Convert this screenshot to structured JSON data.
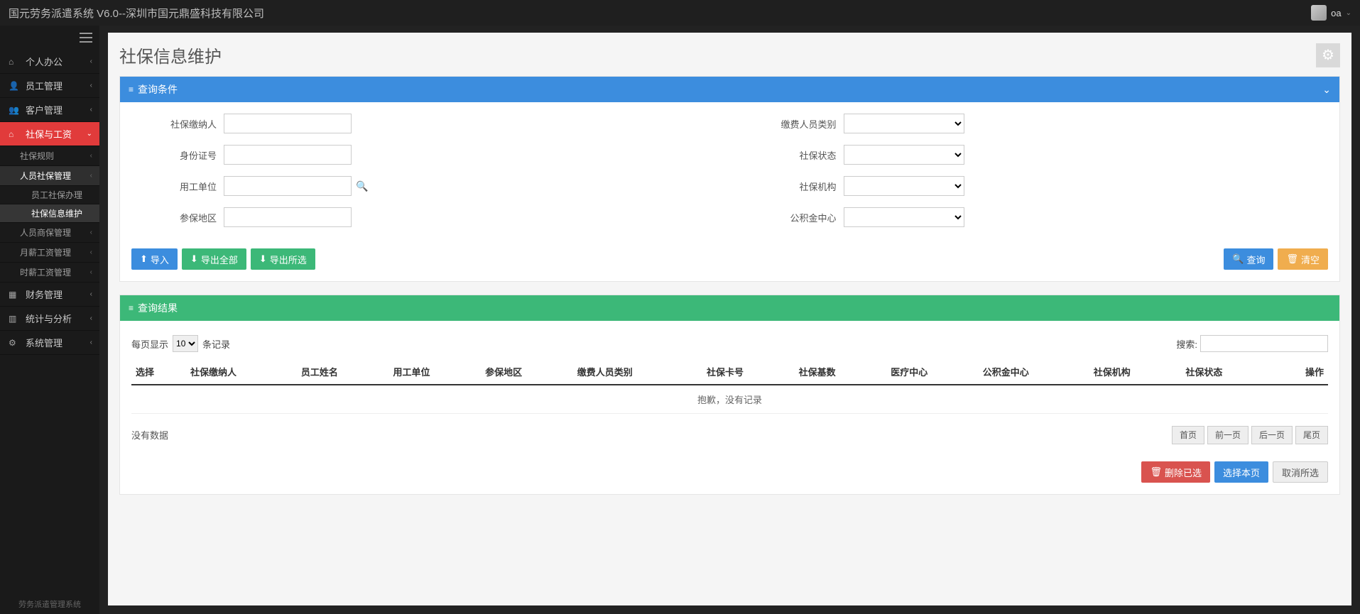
{
  "app_title": "国元劳务派遣系统 V6.0--深圳市国元鼎盛科技有限公司",
  "user": {
    "name": "oa"
  },
  "sidebar": {
    "items": [
      {
        "icon": "home-icon",
        "label": "个人办公",
        "expandable": true
      },
      {
        "icon": "user-icon",
        "label": "员工管理",
        "expandable": true
      },
      {
        "icon": "users-icon",
        "label": "客户管理",
        "expandable": true
      },
      {
        "icon": "home-icon",
        "label": "社保与工资",
        "expandable": true,
        "active": true,
        "children": [
          {
            "label": "社保规则",
            "expandable": true
          },
          {
            "label": "人员社保管理",
            "expandable": true,
            "selected": true,
            "children": [
              {
                "label": "员工社保办理"
              },
              {
                "label": "社保信息维护",
                "selected": true
              }
            ]
          },
          {
            "label": "人员商保管理",
            "expandable": true
          },
          {
            "label": "月薪工资管理",
            "expandable": true
          },
          {
            "label": "时薪工资管理",
            "expandable": true
          }
        ]
      },
      {
        "icon": "dashboard-icon",
        "label": "财务管理",
        "expandable": true
      },
      {
        "icon": "chart-icon",
        "label": "统计与分析",
        "expandable": true
      },
      {
        "icon": "gear-icon",
        "label": "系统管理",
        "expandable": true
      }
    ],
    "footer": "劳务派遣管理系统"
  },
  "page": {
    "title": "社保信息维护",
    "query_panel_title": "查询条件",
    "result_panel_title": "查询结果",
    "form": {
      "left": [
        {
          "key": "payer",
          "label": "社保缴纳人"
        },
        {
          "key": "idno",
          "label": "身份证号"
        },
        {
          "key": "employer",
          "label": "用工单位",
          "lookup": true
        },
        {
          "key": "region",
          "label": "参保地区"
        }
      ],
      "right": [
        {
          "key": "payer_type",
          "label": "缴费人员类别",
          "kind": "select"
        },
        {
          "key": "ss_status",
          "label": "社保状态",
          "kind": "select"
        },
        {
          "key": "ss_org",
          "label": "社保机构",
          "kind": "select"
        },
        {
          "key": "fund_center",
          "label": "公积金中心",
          "kind": "select"
        }
      ]
    },
    "buttons": {
      "import": "导入",
      "export_all": "导出全部",
      "export_selected": "导出所选",
      "query": "查询",
      "clear": "清空"
    },
    "results": {
      "per_page_prefix": "每页显示",
      "per_page_value": "10",
      "per_page_suffix": "条记录",
      "search_label": "搜索:",
      "columns": [
        "选择",
        "社保缴纳人",
        "员工姓名",
        "用工单位",
        "参保地区",
        "缴费人员类别",
        "社保卡号",
        "社保基数",
        "医疗中心",
        "公积金中心",
        "社保机构",
        "社保状态",
        "操作"
      ],
      "empty_row": "抱歉，没有记录",
      "no_data": "没有数据",
      "pager": {
        "first": "首页",
        "prev": "前一页",
        "next": "后一页",
        "last": "尾页"
      }
    },
    "actions": {
      "delete_selected": "删除已选",
      "select_page": "选择本页",
      "deselect_all": "取消所选"
    }
  }
}
